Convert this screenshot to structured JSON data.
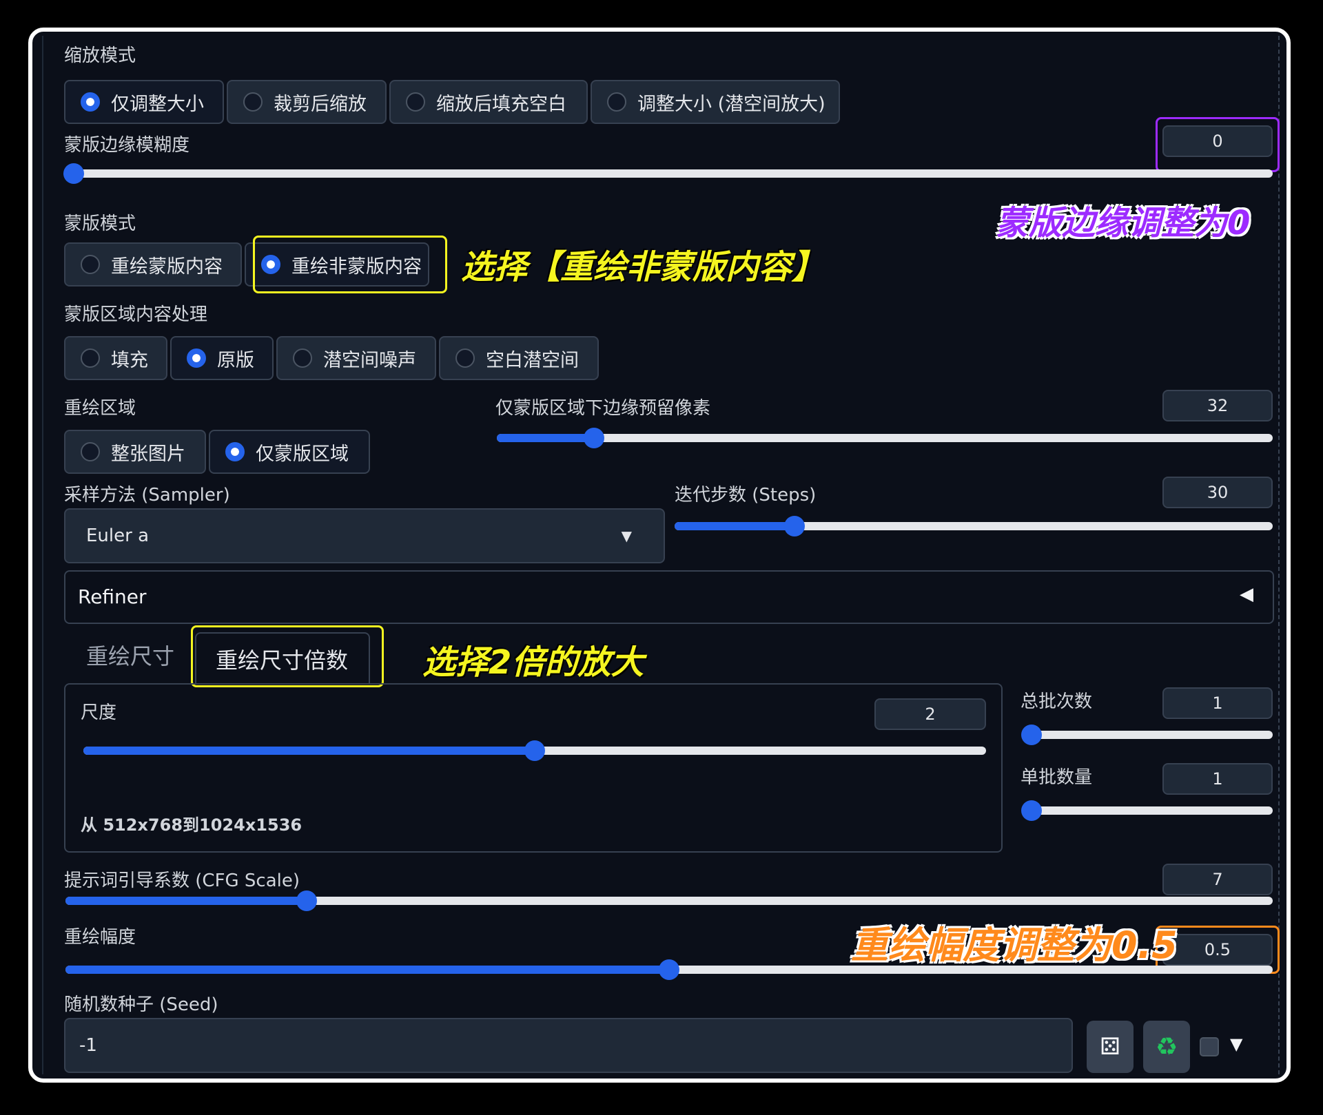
{
  "resize_mode": {
    "label": "缩放模式",
    "options": [
      "仅调整大小",
      "裁剪后缩放",
      "缩放后填充空白",
      "调整大小 (潜空间放大)"
    ],
    "selected": 0
  },
  "mask_blur": {
    "label": "蒙版边缘模糊度",
    "value": "0",
    "fraction": 0.0
  },
  "mask_mode": {
    "label": "蒙版模式",
    "options": [
      "重绘蒙版内容",
      "重绘非蒙版内容"
    ],
    "selected": 1
  },
  "masked_content": {
    "label": "蒙版区域内容处理",
    "options": [
      "填充",
      "原版",
      "潜空间噪声",
      "空白潜空间"
    ],
    "selected": 1
  },
  "inpaint_area": {
    "label": "重绘区域",
    "options": [
      "整张图片",
      "仅蒙版区域"
    ],
    "selected": 1
  },
  "only_masked_padding": {
    "label": "仅蒙版区域下边缘预留像素",
    "value": "32",
    "fraction": 0.125
  },
  "sampler": {
    "label": "采样方法 (Sampler)",
    "value": "Euler a"
  },
  "steps": {
    "label": "迭代步数 (Steps)",
    "value": "30",
    "fraction": 0.2
  },
  "refiner": {
    "label": "Refiner"
  },
  "resize_tabs": {
    "tabs": [
      "重绘尺寸",
      "重绘尺寸倍数"
    ],
    "selected": 1
  },
  "scale": {
    "label": "尺度",
    "value": "2",
    "fraction": 0.5,
    "info": "从 512x768到1024x1536"
  },
  "batch_count": {
    "label": "总批次数",
    "value": "1",
    "fraction": 0.0
  },
  "batch_size": {
    "label": "单批数量",
    "value": "1",
    "fraction": 0.0
  },
  "cfg_scale": {
    "label": "提示词引导系数 (CFG Scale)",
    "value": "7",
    "fraction": 0.2
  },
  "denoising": {
    "label": "重绘幅度",
    "value": "0.5",
    "fraction": 0.5
  },
  "seed": {
    "label": "随机数种子 (Seed)",
    "value": "-1"
  },
  "annotations": {
    "mask_blur": "蒙版边缘调整为0",
    "mask_mode": "选择【重绘非蒙版内容】",
    "scale": "选择2倍的放大",
    "denoising": "重绘幅度调整为0.5"
  },
  "colors": {
    "accent": "#2563eb",
    "purple": "#9d2bff",
    "yellow": "#f5f520",
    "orange": "#ff8a1c"
  },
  "icons": [
    "dice-icon",
    "recycle-icon",
    "caret-down-icon",
    "triangle-left-icon"
  ]
}
